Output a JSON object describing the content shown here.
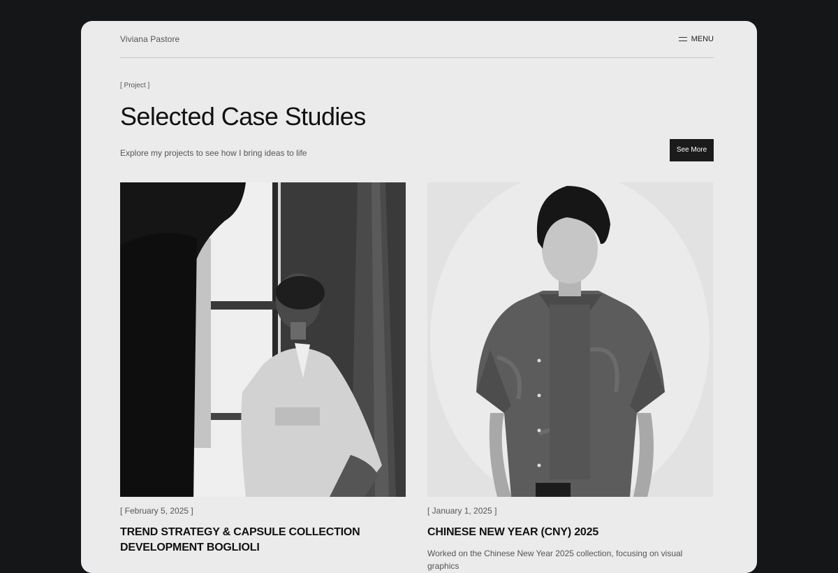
{
  "header": {
    "brand": "Viviana Pastore",
    "menu_label": "MENU"
  },
  "section": {
    "tag": "[ Project ]",
    "title": "Selected Case Studies",
    "subtitle": "Explore my projects to see how I bring ideas to life",
    "see_more_label": "See More"
  },
  "cards": [
    {
      "date": "[ February 5, 2025 ]",
      "title": "TREND STRATEGY & CAPSULE COLLECTION DEVELOPMENT BOGLIOLI",
      "description": ""
    },
    {
      "date": "[ January 1, 2025 ]",
      "title": "CHINESE NEW YEAR (CNY) 2025",
      "description": "Worked on the Chinese New Year 2025 collection, focusing on visual graphics"
    }
  ],
  "colors": {
    "page_background": "#151618",
    "card_background": "#ebebeb",
    "button_background": "#1b1b1b"
  },
  "icons": {
    "menu": "hamburger-icon"
  }
}
